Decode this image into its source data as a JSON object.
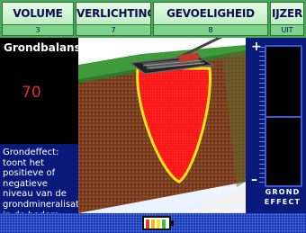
{
  "tabs": [
    {
      "label": "VOLUME",
      "value": "3"
    },
    {
      "label": "VERLICHTING",
      "value": "7"
    },
    {
      "label": "GEVOELIGHEID",
      "value": "8"
    },
    {
      "label": "IJZER",
      "value": "UIT"
    }
  ],
  "panel": {
    "title": "Grondbalans",
    "value": "70",
    "description": "Grondeffect: toont het positieve of negatieve niveau van de grondmineralisatie in de bodem."
  },
  "scale": {
    "plus": "+",
    "minus": "–",
    "label_line1": "GROND",
    "label_line2": "EFFECT"
  },
  "colors": {
    "tab_bar": "#4aa85a",
    "background": "#0a1a7a",
    "value": "#e52a2a",
    "detection_field": "#ff1e1e",
    "field_outline": "#f5e51a",
    "soil": "#7a3d1f",
    "grass": "#3f9a3a"
  },
  "icons": {
    "battery": "battery-icon",
    "coil": "metal-detector-coil-icon"
  },
  "battery": {
    "cells_lit": 4,
    "cells_total": 4
  }
}
